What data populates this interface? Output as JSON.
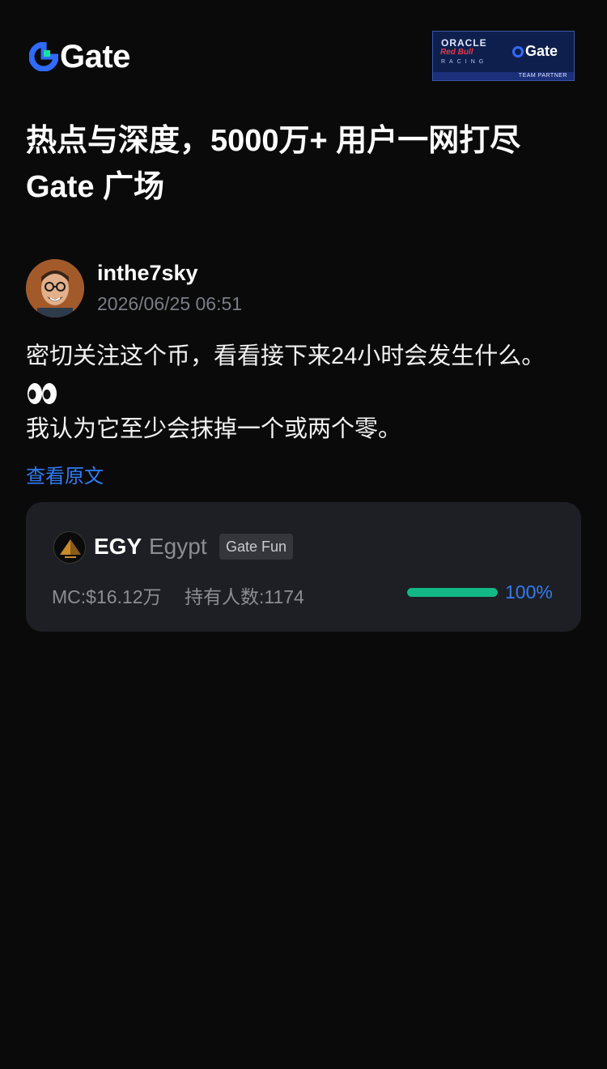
{
  "brand": {
    "logo_text": "Gate",
    "accent_color": "#2f6bff",
    "partner_badge": {
      "oracle": "ORACLE",
      "redbull": "Red Bull",
      "racing": "RACING",
      "gate": "Gate",
      "team": "TEAM PARTNER"
    }
  },
  "headline": {
    "line1": "热点与深度，5000万+ 用户一网打尽",
    "line2": "Gate 广场"
  },
  "post": {
    "author": "inthe7sky",
    "timestamp": "2026/06/25 06:51",
    "line1": "密切关注这个币，看看接下来24小时会发生什么。",
    "emoji": "eyes-emoji",
    "line3": "我认为它至少会抹掉一个或两个零。",
    "view_original": "查看原文"
  },
  "token_card": {
    "symbol": "EGY",
    "name": "Egypt",
    "tag": "Gate Fun",
    "market_cap": "MC:$16.12万",
    "holders": "持有人数:1174",
    "progress_percent": 100,
    "progress_label": "100%",
    "progress_color": "#12b886"
  }
}
